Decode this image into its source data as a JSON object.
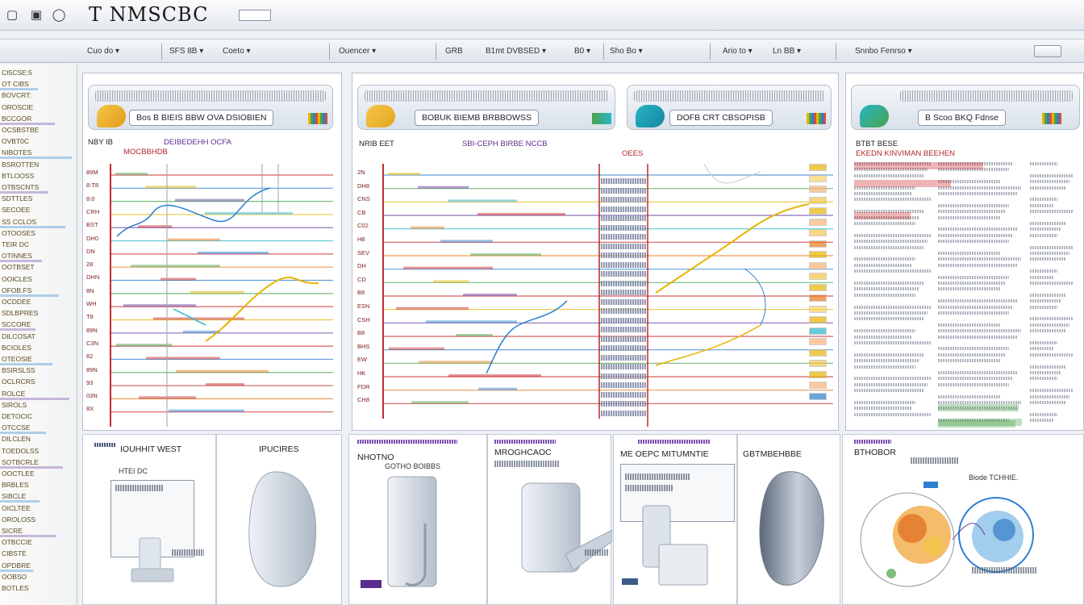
{
  "titlebar": {
    "title": "T NMSCBC",
    "icons": [
      "app-icon-1",
      "app-icon-2",
      "app-icon-3"
    ],
    "icon_glyphs": [
      "▢",
      "▣",
      "◯"
    ]
  },
  "toolbar": {
    "items": [
      "Cuo do ▾",
      "SFS 8B ▾",
      "Coeto ▾",
      "Ouencer ▾",
      "GRB",
      "B1mt DVBSED ▾",
      "B0 ▾",
      "Sho Bo ▾",
      "Ario to ▾",
      "Ln BB ▾",
      "Snnbo Fenrso ▾"
    ]
  },
  "sidebar": {
    "items": [
      "CI5CSE:5",
      "OT CIBS",
      "BOVCRT:",
      "OROSCIE",
      "BCCGOR",
      "OCSBSTBE",
      "OVBT0C",
      "NIBOTES",
      "BSROTTEN",
      "BTLOOSS",
      "OTBSCNTS",
      "SDTTLES",
      "SECOEE",
      "SS CCLOS",
      "OTOOSES",
      "TEIR DC",
      "OTINNES",
      "OOTBSET",
      "OOICLES",
      "OFOB:FS",
      "OCDDEE",
      "SDLBPRES",
      "SCCORE",
      "DILCOSAT",
      "BCIOLES",
      "OTEOSIE",
      "BSIRSLSS",
      "OCLRCRS",
      "ROLCE",
      "SIROLS",
      "DETOCIC",
      "OTCCSE",
      "DILCLEN",
      "TOEDOLSS",
      "SOTBCRLE",
      "OOCTLEE",
      "BRBLES",
      "SIBCLE",
      "OICLTEE",
      "OROLOSS",
      "SICRE",
      "OTBCCIE",
      "CIBSTE",
      "OPDBRE",
      "OOBSO",
      "BOTLES"
    ]
  },
  "panel1": {
    "header_pill": "Bos B BIEIS BBW OVA DSIOBIEN",
    "label_a": "NBY IB",
    "label_b": "MOCBBHDB",
    "label_c": "DEIBEDEHH OCFA",
    "row_ticks": [
      "89M",
      "8:T8",
      "8:0",
      "CRH",
      "BST",
      "DH0",
      "DN",
      "28",
      "DHN",
      "8N",
      "WH",
      "T8",
      "89N",
      "C3N",
      "82",
      "89N",
      "93",
      "03N",
      "8X"
    ]
  },
  "panel2": {
    "header_pill": "BOBUK  BIEMB BRBBOWSS",
    "header_pill_2": "DOFB CRT CBSOPISB",
    "label_a": "NRIB EET",
    "label_b": "SBI-CEPH BIRBE NCCB",
    "label_c": "OEES",
    "row_ticks": [
      "2N",
      "DH8",
      "CNS",
      "CB",
      "C02",
      "H8",
      "SEV",
      "DH",
      "CD",
      "B8",
      "ESN",
      "CSH",
      "B8",
      "BHS",
      "EW",
      "HK",
      "FDR",
      "CH8"
    ]
  },
  "panel3": {
    "header_pill": "B Scoo  BKQ Fdnse",
    "label_a": "BTBT BESE",
    "label_b": "EKEDN KINVIMAN BEEHEN"
  },
  "cards": {
    "c1_title": "IOUHHIT  WEST",
    "c1_sub": "HTEI DC",
    "c2_title": "IPUCIRES",
    "c3_title": "NHOTNO",
    "c3_sub": "GOTHO BOIBBS",
    "c4_title": "MROGHCAOC",
    "c5_title": "ME OEPC MITUMNTIE",
    "c6_title": "GBTMBEHBBE",
    "c7_title": "BTHOBOR",
    "c7_sub": "Biode TCHHIE."
  },
  "colors": {
    "accent_red": "#c8282a",
    "accent_purple": "#6a3ea1",
    "accent_blue": "#2b7fd0",
    "accent_green": "#49a34b",
    "accent_yellow": "#e8b400",
    "accent_orange": "#e77a1d"
  }
}
